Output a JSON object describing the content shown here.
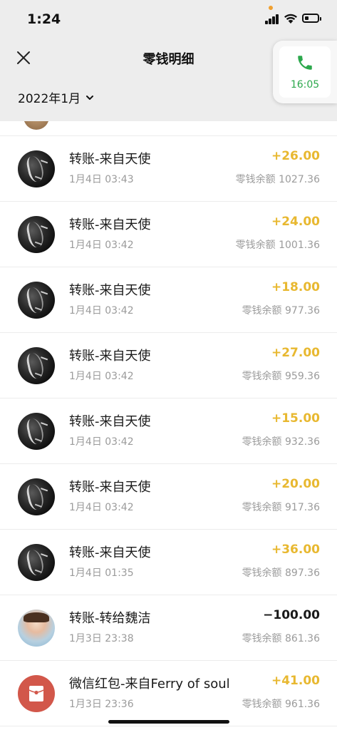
{
  "status_bar": {
    "time": "1:24"
  },
  "nav": {
    "title": "零钱明细"
  },
  "filter": {
    "month": "2022年1月"
  },
  "call_bubble": {
    "time": "16:05",
    "color": "#2ca84c"
  },
  "transactions": [
    {
      "title": "转账-来自天使",
      "date": "1月4日 03:43",
      "amount": "+26.00",
      "balance": "零钱余额 1027.36",
      "avatar": "dark",
      "type": "income"
    },
    {
      "title": "转账-来自天使",
      "date": "1月4日 03:42",
      "amount": "+24.00",
      "balance": "零钱余额 1001.36",
      "avatar": "dark",
      "type": "income"
    },
    {
      "title": "转账-来自天使",
      "date": "1月4日 03:42",
      "amount": "+18.00",
      "balance": "零钱余额 977.36",
      "avatar": "dark",
      "type": "income"
    },
    {
      "title": "转账-来自天使",
      "date": "1月4日 03:42",
      "amount": "+27.00",
      "balance": "零钱余额 959.36",
      "avatar": "dark",
      "type": "income"
    },
    {
      "title": "转账-来自天使",
      "date": "1月4日 03:42",
      "amount": "+15.00",
      "balance": "零钱余额 932.36",
      "avatar": "dark",
      "type": "income"
    },
    {
      "title": "转账-来自天使",
      "date": "1月4日 03:42",
      "amount": "+20.00",
      "balance": "零钱余额 917.36",
      "avatar": "dark",
      "type": "income"
    },
    {
      "title": "转账-来自天使",
      "date": "1月4日 01:35",
      "amount": "+36.00",
      "balance": "零钱余额 897.36",
      "avatar": "dark",
      "type": "income"
    },
    {
      "title": "转账-转给魏洁",
      "date": "1月3日 23:38",
      "amount": "−100.00",
      "balance": "零钱余额 861.36",
      "avatar": "photo",
      "type": "expense"
    },
    {
      "title": "微信红包-来自Ferry of soul",
      "date": "1月3日 23:36",
      "amount": "+41.00",
      "balance": "零钱余额 961.36",
      "avatar": "redpacket",
      "type": "income"
    }
  ],
  "colors": {
    "income": "#e8b830",
    "expense": "#1a1a1a",
    "header_bg": "#ededed"
  }
}
